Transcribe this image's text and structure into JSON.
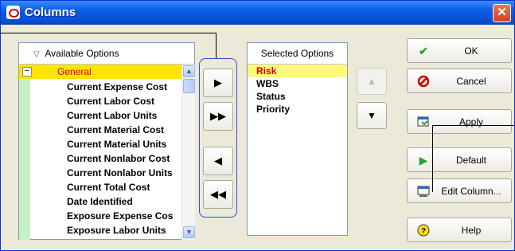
{
  "window": {
    "title": "Columns",
    "close_glyph": "✕"
  },
  "available": {
    "header": "Available Options",
    "group_label": "General",
    "group_toggle": "−",
    "options": [
      "Current Expense Cost",
      "Current Labor Cost",
      "Current Labor Units",
      "Current Material Cost",
      "Current Material Units",
      "Current Nonlabor Cost",
      "Current Nonlabor Units",
      "Current Total Cost",
      "Date Identified",
      "Exposure Expense Cos",
      "Exposure Labor Units"
    ]
  },
  "move_buttons": {
    "add_one": "▶",
    "add_all": "▶▶",
    "remove_one": "◀",
    "remove_all": "◀◀"
  },
  "selected": {
    "header": "Selected Options",
    "items": [
      "Risk",
      "WBS",
      "Status",
      "Priority"
    ]
  },
  "order_buttons": {
    "up": "▲",
    "down": "▼"
  },
  "actions": {
    "ok": "OK",
    "cancel": "Cancel",
    "apply": "Apply",
    "default": "Default",
    "edit_column": "Edit Column...",
    "help": "Help"
  },
  "icons": {
    "ok": "checkmark-icon",
    "cancel": "no-entry-icon",
    "apply": "apply-icon",
    "default": "play-icon",
    "edit_column": "edit-column-icon",
    "help": "help-icon"
  },
  "colors": {
    "title_bar": "#0A4FD6",
    "highlight_yellow": "#FFE400",
    "selected_red": "#D00000",
    "ok_green": "#2E9E2E"
  }
}
